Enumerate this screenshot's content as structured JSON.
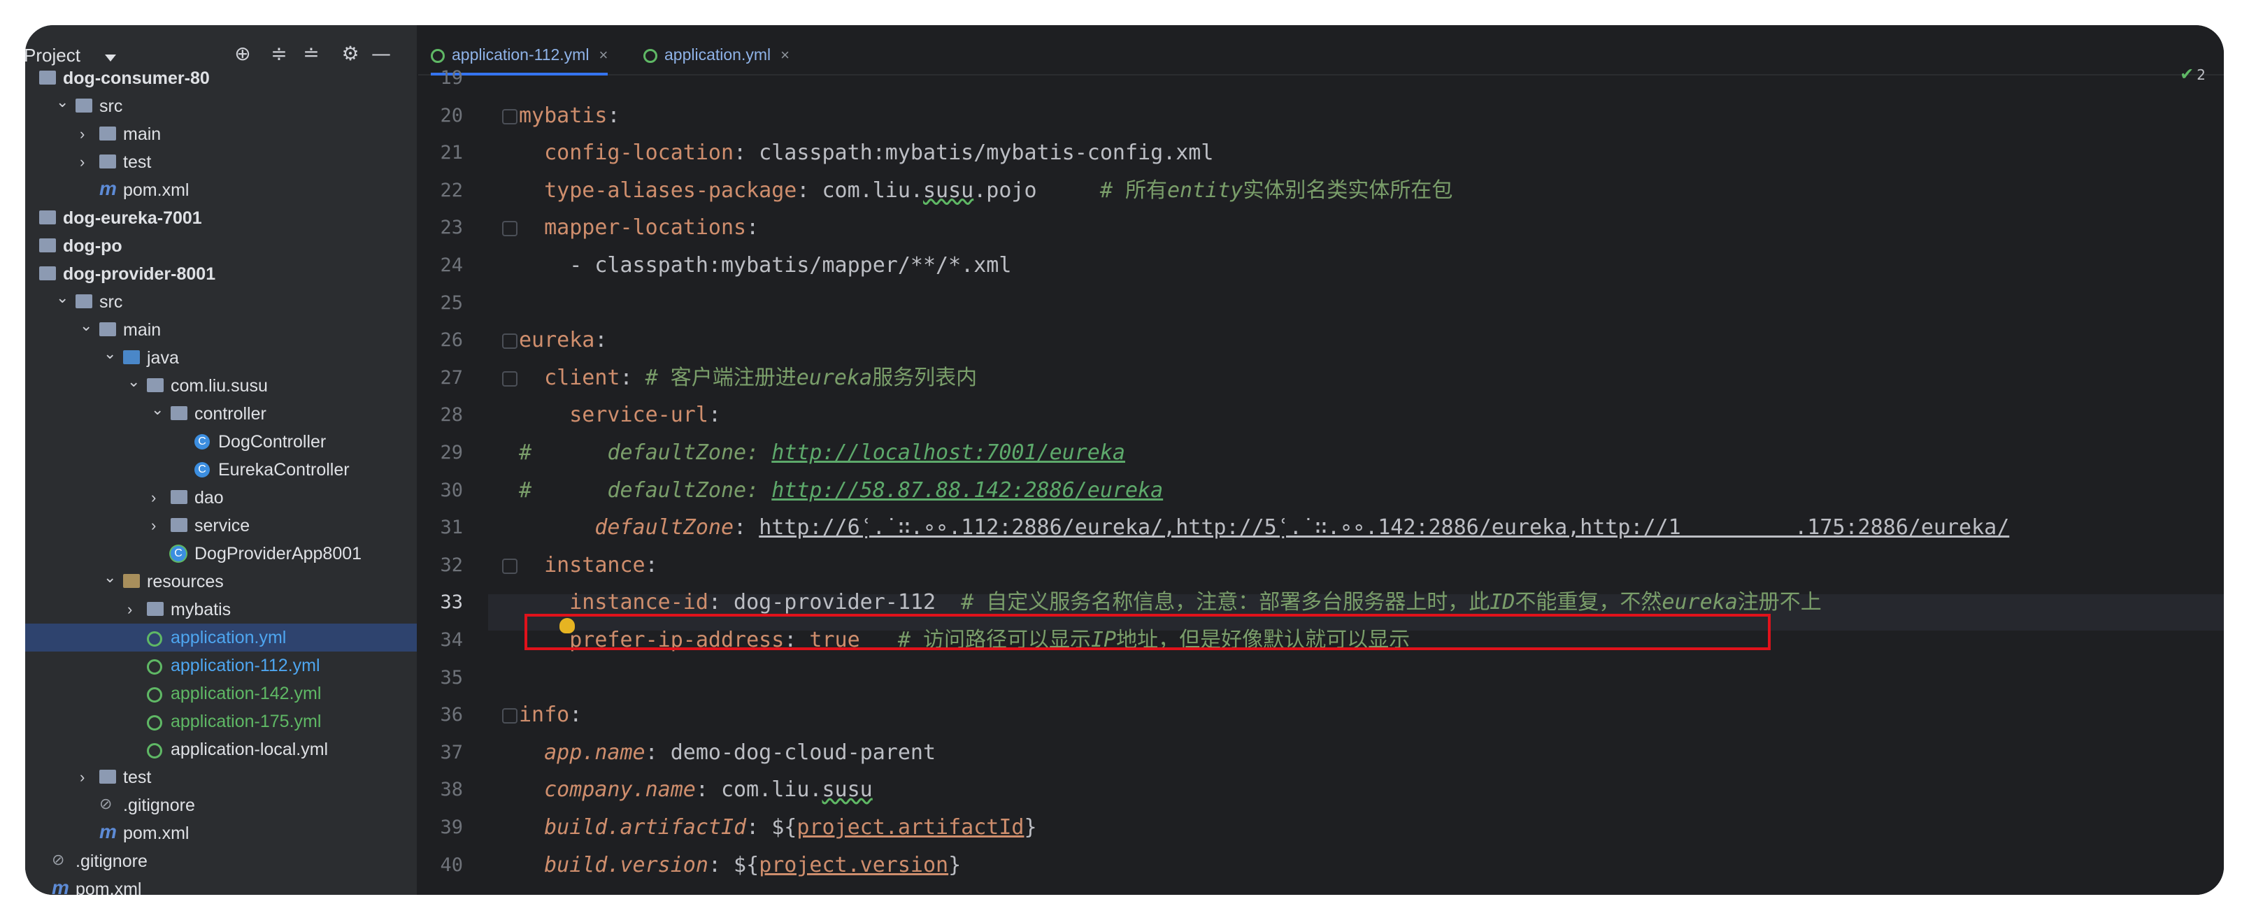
{
  "project_panel": {
    "title": "Project",
    "tree": [
      {
        "label": "dog-consumer-80",
        "level": 0,
        "type": "module",
        "bold": true
      },
      {
        "label": "src",
        "level": 1,
        "type": "folder",
        "expanded": true
      },
      {
        "label": "main",
        "level": 2,
        "type": "folder",
        "expanded": false
      },
      {
        "label": "test",
        "level": 2,
        "type": "folder",
        "expanded": false
      },
      {
        "label": "pom.xml",
        "level": 2,
        "type": "maven"
      },
      {
        "label": "dog-eureka-7001",
        "level": 0,
        "type": "module",
        "bold": true
      },
      {
        "label": "dog-po",
        "level": 0,
        "type": "module",
        "bold": true
      },
      {
        "label": "dog-provider-8001",
        "level": 0,
        "type": "module",
        "bold": true
      },
      {
        "label": "src",
        "level": 1,
        "type": "folder",
        "expanded": true
      },
      {
        "label": "main",
        "level": 2,
        "type": "folder",
        "expanded": true
      },
      {
        "label": "java",
        "level": 3,
        "type": "folder-blue",
        "expanded": true
      },
      {
        "label": "com.liu.susu",
        "level": 4,
        "type": "package",
        "expanded": true
      },
      {
        "label": "controller",
        "level": 5,
        "type": "package",
        "expanded": true
      },
      {
        "label": "DogController",
        "level": 6,
        "type": "class"
      },
      {
        "label": "EurekaController",
        "level": 6,
        "type": "class"
      },
      {
        "label": "dao",
        "level": 5,
        "type": "package",
        "expanded": false
      },
      {
        "label": "service",
        "level": 5,
        "type": "package",
        "expanded": false
      },
      {
        "label": "DogProviderApp8001",
        "level": 5,
        "type": "spring-class"
      },
      {
        "label": "resources",
        "level": 3,
        "type": "resources",
        "expanded": true
      },
      {
        "label": "mybatis",
        "level": 4,
        "type": "folder",
        "expanded": false
      },
      {
        "label": "application.yml",
        "level": 4,
        "type": "yml",
        "color": "blue",
        "selected": true
      },
      {
        "label": "application-112.yml",
        "level": 4,
        "type": "yml",
        "color": "blue"
      },
      {
        "label": "application-142.yml",
        "level": 4,
        "type": "yml",
        "color": "green"
      },
      {
        "label": "application-175.yml",
        "level": 4,
        "type": "yml",
        "color": "green"
      },
      {
        "label": "application-local.yml",
        "level": 4,
        "type": "yml",
        "color": "normal"
      },
      {
        "label": "test",
        "level": 2,
        "type": "folder",
        "expanded": false
      },
      {
        "label": ".gitignore",
        "level": 2,
        "type": "git"
      },
      {
        "label": "pom.xml",
        "level": 2,
        "type": "maven"
      },
      {
        "label": ".gitignore",
        "level": 0,
        "type": "git"
      },
      {
        "label": "pom.xml",
        "level": 0,
        "type": "maven"
      }
    ]
  },
  "editor": {
    "tabs": [
      {
        "label": "application-112.yml",
        "active": true
      },
      {
        "label": "application.yml",
        "active": false
      }
    ],
    "inspection_count": "2",
    "current_line": "33",
    "lines": [
      {
        "n": "19",
        "parts": []
      },
      {
        "n": "20",
        "parts": [
          [
            "k",
            "mybatis"
          ],
          [
            "p",
            ":"
          ]
        ]
      },
      {
        "n": "21",
        "parts": [
          [
            "p",
            "  "
          ],
          [
            "k",
            "config-location"
          ],
          [
            "p",
            ": classpath:mybatis/mybatis-config.xml"
          ]
        ]
      },
      {
        "n": "22",
        "parts": [
          [
            "p",
            "  "
          ],
          [
            "k",
            "type-aliases-package"
          ],
          [
            "p",
            ": com.liu."
          ],
          [
            "su",
            "susu"
          ],
          [
            "p",
            ".pojo     "
          ],
          [
            "c",
            "# 所有"
          ],
          [
            "ci",
            "entity"
          ],
          [
            "c",
            "实体别名类实体所在包"
          ]
        ]
      },
      {
        "n": "23",
        "parts": [
          [
            "p",
            "  "
          ],
          [
            "k",
            "mapper-locations"
          ],
          [
            "p",
            ":"
          ]
        ]
      },
      {
        "n": "24",
        "parts": [
          [
            "p",
            "    - classpath:mybatis/mapper/**/*.xml"
          ]
        ]
      },
      {
        "n": "25",
        "parts": []
      },
      {
        "n": "26",
        "parts": [
          [
            "k",
            "eureka"
          ],
          [
            "p",
            ":"
          ]
        ]
      },
      {
        "n": "27",
        "parts": [
          [
            "p",
            "  "
          ],
          [
            "k",
            "client"
          ],
          [
            "p",
            ": "
          ],
          [
            "c",
            "# 客户端注册进"
          ],
          [
            "ci",
            "eureka"
          ],
          [
            "c",
            "服务列表内"
          ]
        ]
      },
      {
        "n": "28",
        "parts": [
          [
            "p",
            "    "
          ],
          [
            "k",
            "service-url"
          ],
          [
            "p",
            ":"
          ]
        ]
      },
      {
        "n": "29",
        "parts": [
          [
            "c",
            "#"
          ],
          [
            "p",
            "      "
          ],
          [
            "ci",
            "defaultZone: "
          ],
          [
            "u",
            "http://localhost:7001/eureka"
          ]
        ]
      },
      {
        "n": "30",
        "parts": [
          [
            "c",
            "#"
          ],
          [
            "p",
            "      "
          ],
          [
            "ci",
            "defaultZone: "
          ],
          [
            "u",
            "http://58.87.88.142:2886/eureka"
          ]
        ]
      },
      {
        "n": "31",
        "parts": [
          [
            "p",
            "      "
          ],
          [
            "it",
            "defaultZone"
          ],
          [
            "p",
            ": "
          ],
          [
            "lnk",
            "http://6̣ʿ.˙∷.∘∘.112:2886/eureka/,http://5̣ʿ.˙∷.∘∘.142:2886/eureka,http://1         .175:2886/eureka/"
          ]
        ]
      },
      {
        "n": "32",
        "parts": [
          [
            "p",
            "  "
          ],
          [
            "k",
            "instance"
          ],
          [
            "p",
            ":"
          ]
        ]
      },
      {
        "n": "33",
        "parts": [
          [
            "p",
            "    "
          ],
          [
            "k",
            "instance-id"
          ],
          [
            "p",
            ": dog-provider-112  "
          ],
          [
            "c",
            "# 自定义服务名称信息，注意：部署多台服务器上时，此"
          ],
          [
            "ci",
            "ID"
          ],
          [
            "c",
            "不能重复，不然"
          ],
          [
            "ci",
            "eureka"
          ],
          [
            "c",
            "注册不上"
          ]
        ]
      },
      {
        "n": "34",
        "parts": [
          [
            "p",
            "    "
          ],
          [
            "k",
            "prefer-ip-address"
          ],
          [
            "p",
            ": "
          ],
          [
            "k",
            "true"
          ],
          [
            "p",
            "   "
          ],
          [
            "c",
            "# 访问路径可以显示"
          ],
          [
            "ci",
            "IP"
          ],
          [
            "c",
            "地址，但是好像默认就可以显示"
          ]
        ]
      },
      {
        "n": "35",
        "parts": []
      },
      {
        "n": "36",
        "parts": [
          [
            "k",
            "info"
          ],
          [
            "p",
            ":"
          ]
        ]
      },
      {
        "n": "37",
        "parts": [
          [
            "p",
            "  "
          ],
          [
            "it",
            "app.name"
          ],
          [
            "p",
            ": demo-dog-cloud-parent"
          ]
        ]
      },
      {
        "n": "38",
        "parts": [
          [
            "p",
            "  "
          ],
          [
            "it",
            "company.name"
          ],
          [
            "p",
            ": com.liu."
          ],
          [
            "su",
            "susu"
          ]
        ]
      },
      {
        "n": "39",
        "parts": [
          [
            "p",
            "  "
          ],
          [
            "it",
            "build.artifactId"
          ],
          [
            "p",
            ": ${"
          ],
          [
            "ku",
            "project.artifactId"
          ],
          [
            "p",
            "}"
          ]
        ]
      },
      {
        "n": "40",
        "parts": [
          [
            "p",
            "  "
          ],
          [
            "it",
            "build.version"
          ],
          [
            "p",
            ": ${"
          ],
          [
            "ku",
            "project.version"
          ],
          [
            "p",
            "}"
          ]
        ]
      }
    ]
  }
}
